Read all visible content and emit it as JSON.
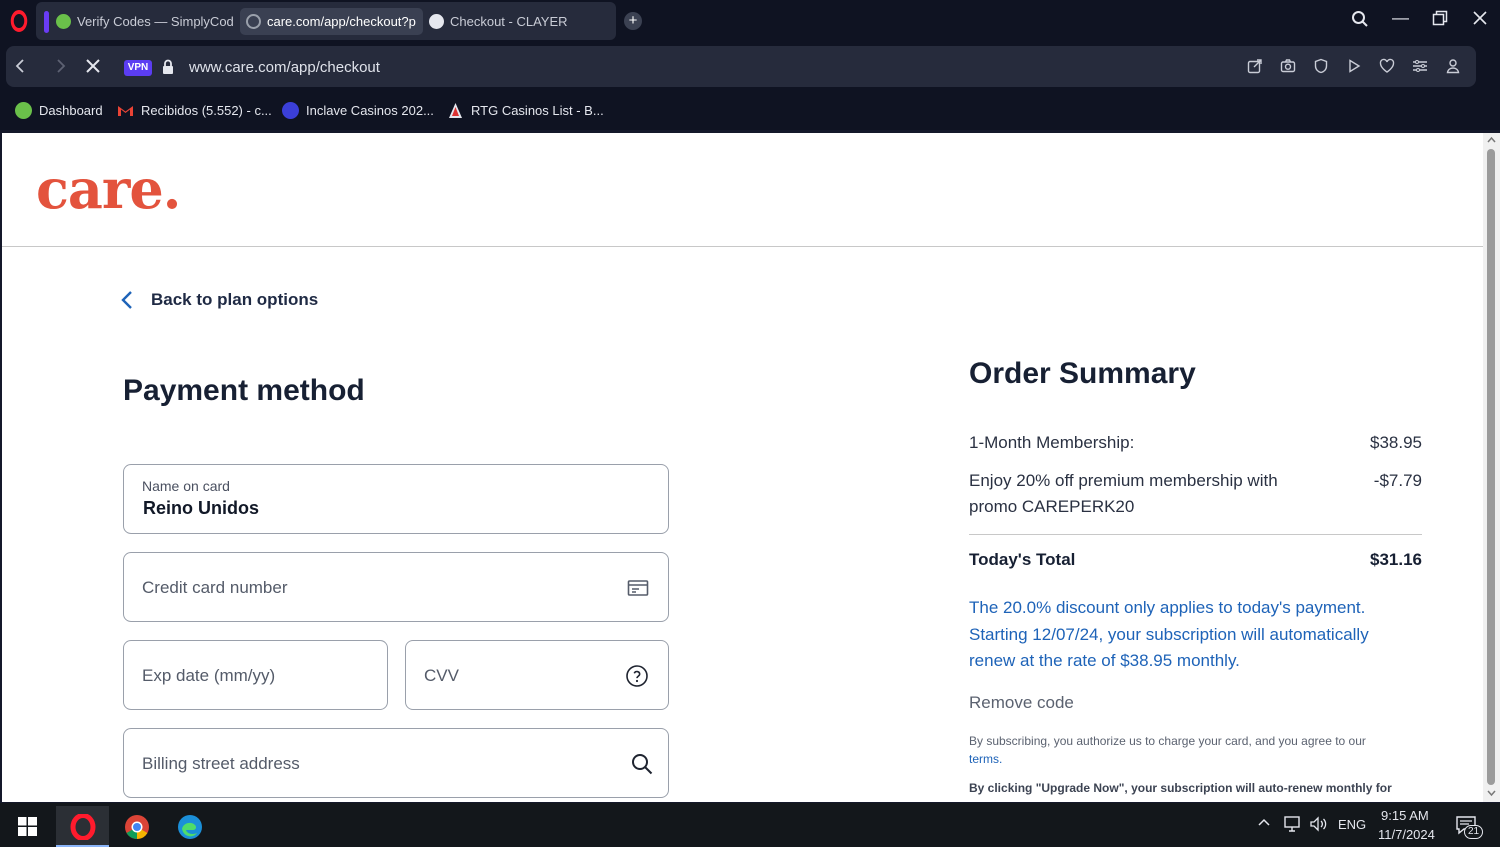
{
  "browser": {
    "tabs": [
      {
        "label": "Verify Codes — SimplyCodes",
        "active": false
      },
      {
        "label": "care.com/app/checkout?p",
        "active": true
      },
      {
        "label": "Checkout - CLAYER",
        "active": false
      }
    ],
    "address": {
      "vpn_label": "VPN",
      "url": "www.care.com/app/checkout"
    },
    "bookmarks": [
      {
        "label": "Dashboard"
      },
      {
        "label": "Recibidos (5.552) - c..."
      },
      {
        "label": "Inclave Casinos 202..."
      },
      {
        "label": "RTG Casinos List - B..."
      }
    ]
  },
  "page": {
    "logo_text": "care.",
    "back_label": "Back to plan options",
    "payment_title": "Payment method",
    "fields": {
      "name_label": "Name on card",
      "name_value": "Reino Unidos",
      "card_placeholder": "Credit card number",
      "exp_placeholder": "Exp date (mm/yy)",
      "cvv_placeholder": "CVV",
      "address_placeholder": "Billing street address"
    },
    "summary": {
      "title": "Order Summary",
      "membership_label": "1-Month Membership:",
      "membership_amount": "$38.95",
      "promo_line1": "Enjoy 20% off premium membership with",
      "promo_line2": "promo CAREPERK20",
      "promo_amount": "-$7.79",
      "total_label": "Today's Total",
      "total_amount": "$31.16",
      "note": "The 20.0% discount only applies to today's payment. Starting 12/07/24, your subscription will automatically renew at the rate of $38.95 monthly.",
      "remove_code": "Remove code",
      "legal_text": "By subscribing, you authorize us to charge your card, and you agree to our",
      "legal_link": "terms.",
      "legal_bold": "By clicking \"Upgrade Now\", your subscription will auto-renew monthly for"
    }
  },
  "taskbar": {
    "lang": "ENG",
    "time": "9:15 AM",
    "date": "11/7/2024",
    "notification_count": "21"
  },
  "colors": {
    "brand": "#e3533d",
    "link": "#1e63b8",
    "browser_accent": "#6a3cf5"
  }
}
